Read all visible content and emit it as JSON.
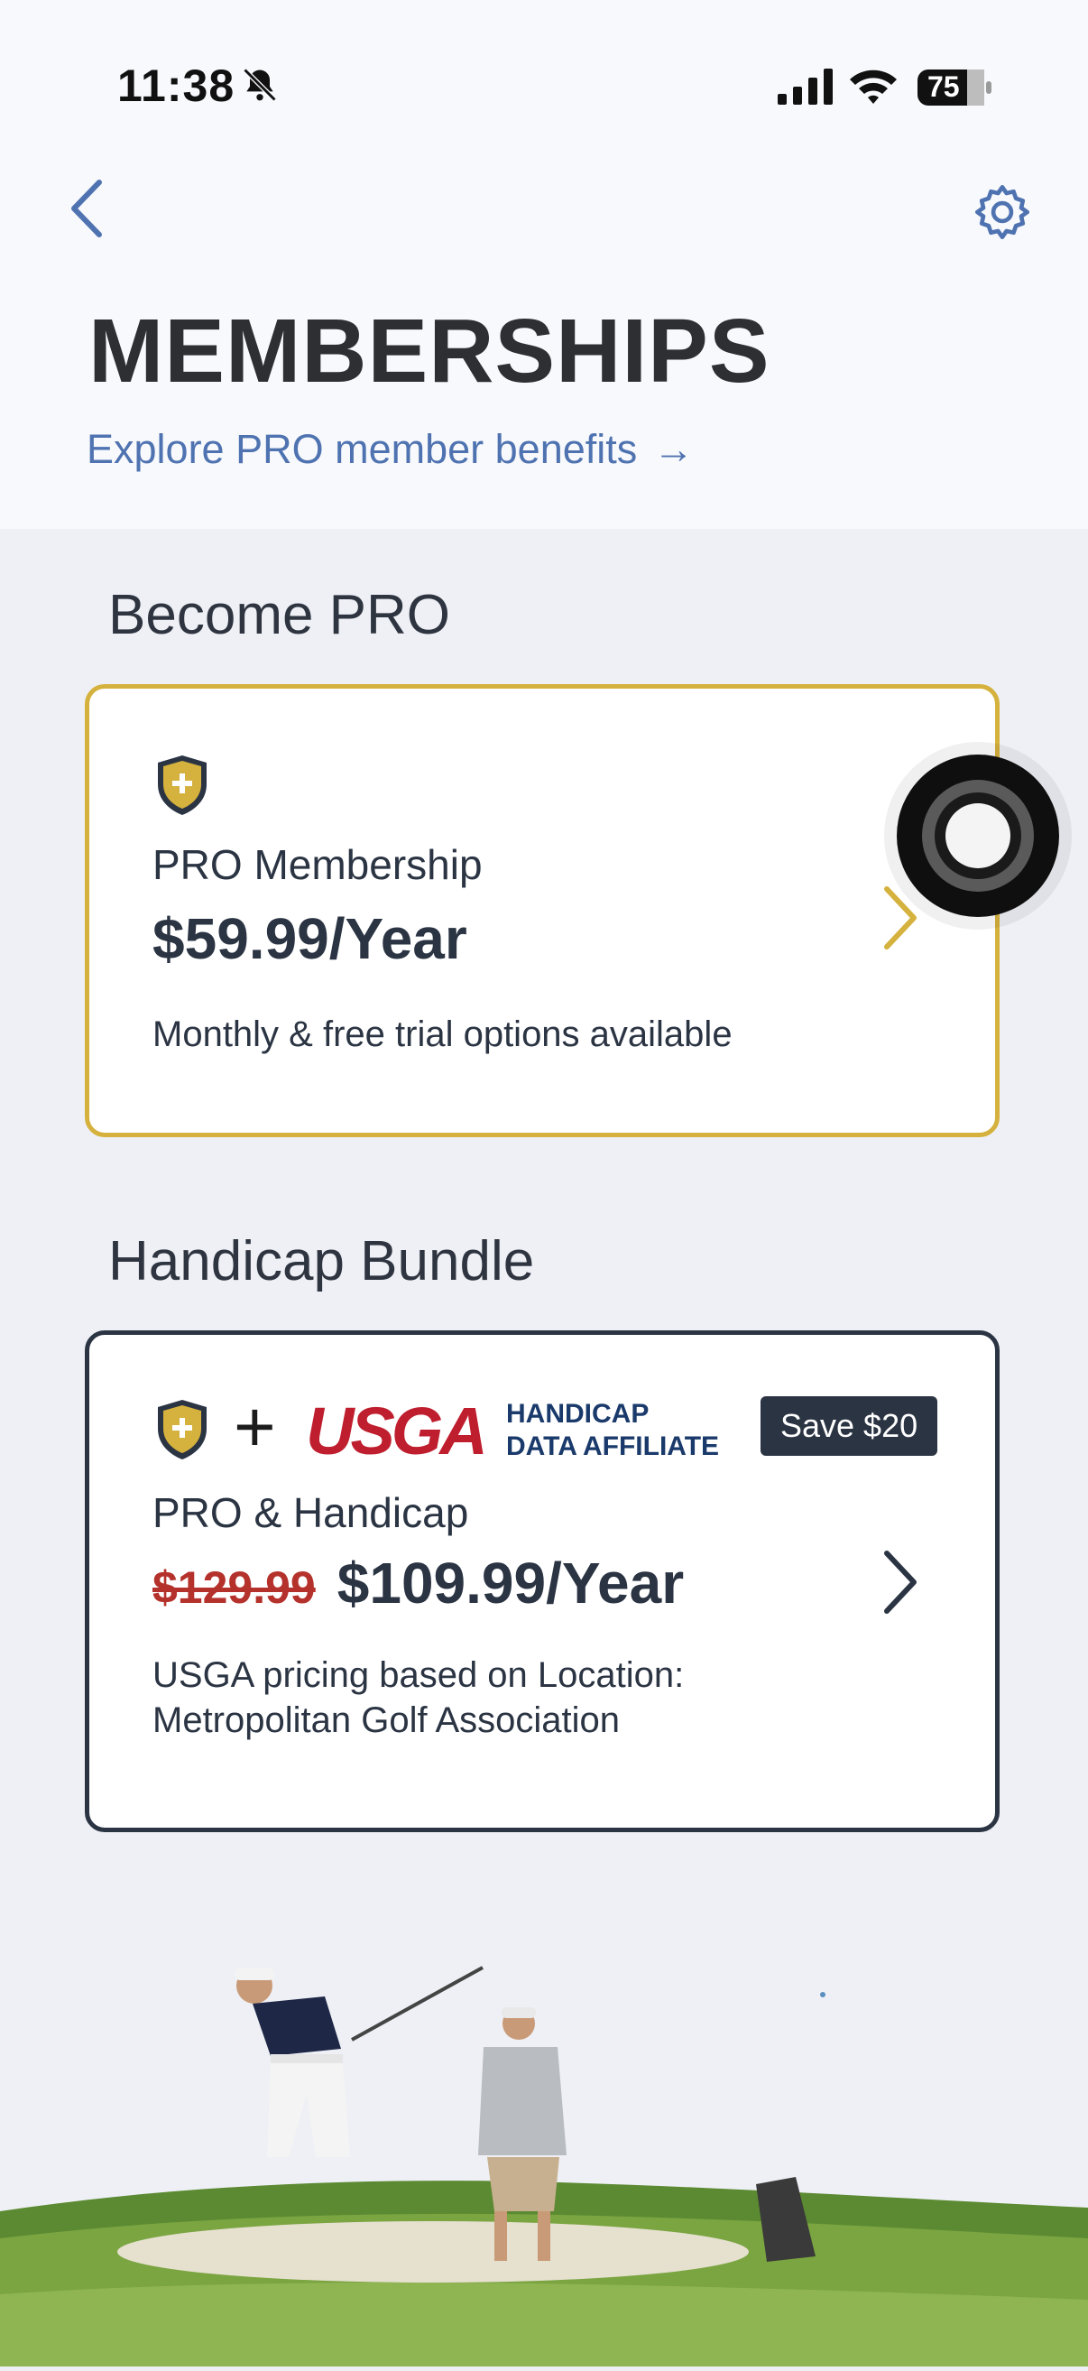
{
  "status_bar": {
    "time": "11:38",
    "battery": "75",
    "icons": [
      "bell-slash-icon",
      "cellular-signal-icon",
      "wifi-icon",
      "battery-icon"
    ]
  },
  "header": {
    "back_icon": "chevron-left-icon",
    "settings_icon": "gear-icon",
    "title": "MEMBERSHIPS",
    "explore_link": "Explore PRO member benefits",
    "explore_arrow": "→"
  },
  "become_pro": {
    "heading": "Become PRO",
    "card": {
      "icon": "pro-shield-icon",
      "name": "PRO Membership",
      "price": "$59.99/Year",
      "note": "Monthly & free trial options available",
      "accent": "#d5b13d"
    }
  },
  "handicap_bundle": {
    "heading": "Handicap Bundle",
    "card": {
      "plus": "+",
      "usga_logo": "USGA",
      "affiliate_line1": "HANDICAP",
      "affiliate_line2": "DATA AFFILIATE",
      "badge": "Save $20",
      "name": "PRO & Handicap",
      "old_price": "$129.99",
      "price": "$109.99/Year",
      "note_line1": "USGA pricing based on Location:",
      "note_line2": "Metropolitan Golf Association",
      "accent": "#2b3443"
    }
  },
  "colors": {
    "link": "#4f73b1",
    "gold": "#d5b13d",
    "navy": "#2b3443",
    "strike_red": "#b5322c",
    "background": "#eef0f5"
  }
}
